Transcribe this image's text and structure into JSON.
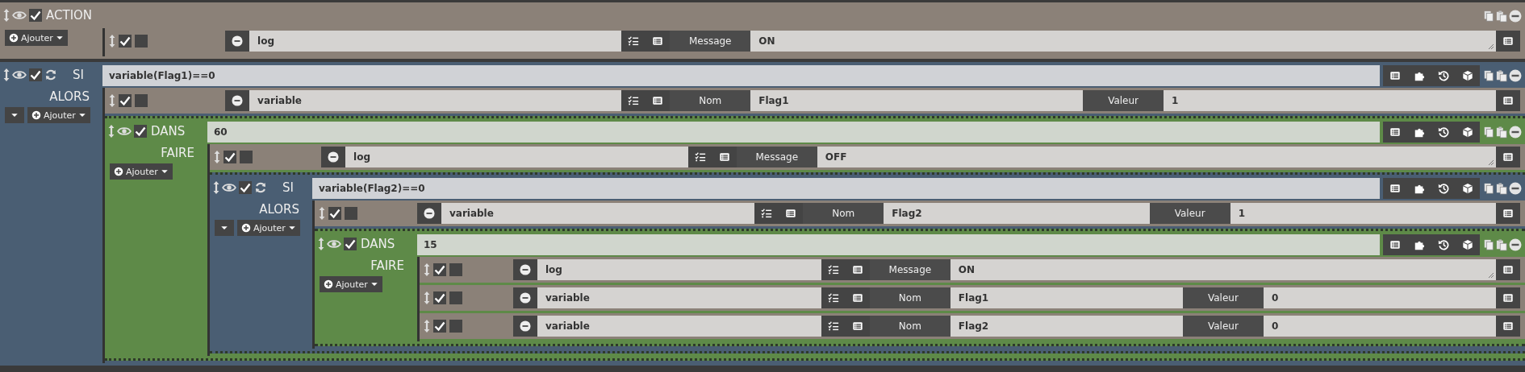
{
  "blocks": [
    {
      "kind": "action_block",
      "label": "ACTION",
      "enabled": true,
      "add_button": "Ajouter",
      "items": [
        {
          "kind": "action",
          "enabled": true,
          "parallel": false,
          "command": "log",
          "params": [
            {
              "label": "Message",
              "value": "ON",
              "multiline": true
            }
          ]
        }
      ]
    },
    {
      "kind": "if",
      "label": "SI",
      "enabled": true,
      "expression": "variable(Flag1)==0",
      "section_label": "ALORS",
      "add_button": "Ajouter",
      "items": [
        {
          "kind": "action",
          "enabled": true,
          "parallel": false,
          "command": "variable",
          "params": [
            {
              "label": "Nom",
              "value": "Flag1",
              "multiline": false
            },
            {
              "label": "Valeur",
              "value": "1",
              "multiline": false
            }
          ]
        },
        {
          "kind": "in",
          "label": "DANS",
          "enabled": true,
          "expression": "60",
          "section_label": "FAIRE",
          "add_button": "Ajouter",
          "items": [
            {
              "kind": "action",
              "enabled": true,
              "parallel": false,
              "command": "log",
              "params": [
                {
                  "label": "Message",
                  "value": "OFF",
                  "multiline": true
                }
              ]
            },
            {
              "kind": "if",
              "label": "SI",
              "enabled": true,
              "expression": "variable(Flag2)==0",
              "section_label": "ALORS",
              "add_button": "Ajouter",
              "items": [
                {
                  "kind": "action",
                  "enabled": true,
                  "parallel": false,
                  "command": "variable",
                  "params": [
                    {
                      "label": "Nom",
                      "value": "Flag2",
                      "multiline": false
                    },
                    {
                      "label": "Valeur",
                      "value": "1",
                      "multiline": false
                    }
                  ]
                },
                {
                  "kind": "in",
                  "label": "DANS",
                  "enabled": true,
                  "expression": "15",
                  "section_label": "FAIRE",
                  "add_button": "Ajouter",
                  "items": [
                    {
                      "kind": "action",
                      "enabled": true,
                      "parallel": false,
                      "command": "log",
                      "params": [
                        {
                          "label": "Message",
                          "value": "ON",
                          "multiline": true
                        }
                      ]
                    },
                    {
                      "kind": "action",
                      "enabled": true,
                      "parallel": false,
                      "command": "variable",
                      "params": [
                        {
                          "label": "Nom",
                          "value": "Flag1",
                          "multiline": false
                        },
                        {
                          "label": "Valeur",
                          "value": "0",
                          "multiline": false
                        }
                      ]
                    },
                    {
                      "kind": "action",
                      "enabled": true,
                      "parallel": false,
                      "command": "variable",
                      "params": [
                        {
                          "label": "Nom",
                          "value": "Flag2",
                          "multiline": false
                        },
                        {
                          "label": "Valeur",
                          "value": "0",
                          "multiline": false
                        }
                      ]
                    }
                  ]
                }
              ]
            }
          ]
        }
      ]
    }
  ]
}
